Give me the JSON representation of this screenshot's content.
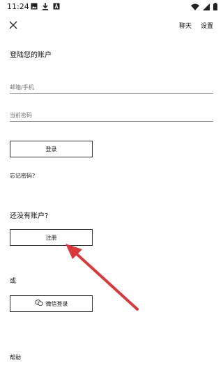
{
  "status_bar": {
    "time": "11:24",
    "left_icons": [
      "image-icon",
      "download-icon",
      "font-icon"
    ],
    "right_icons": [
      "wifi-icon",
      "signal-icon",
      "battery-icon"
    ]
  },
  "top_bar": {
    "chat_label": "聊天",
    "settings_label": "设置"
  },
  "login": {
    "title": "登陆您的账户",
    "email_placeholder": "邮箱/手机",
    "password_placeholder": "当前密码",
    "login_button": "登录",
    "forgot_password": "忘记密码?"
  },
  "register": {
    "prompt": "还没有账户?",
    "register_button": "注册"
  },
  "alt": {
    "or_label": "或",
    "wechat_button": "微信登录"
  },
  "footer": {
    "help_label": "帮助"
  },
  "colors": {
    "annotation_arrow": "#d9393c",
    "button_border": "#333333",
    "text": "#111111"
  }
}
